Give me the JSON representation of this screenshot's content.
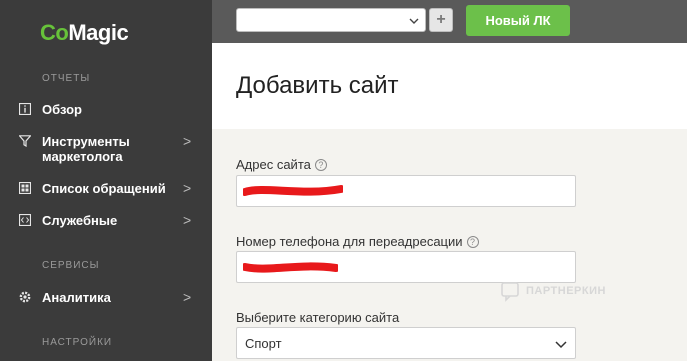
{
  "brand": {
    "logo_co": "Co",
    "logo_magic": "Magic",
    "accent": "#67c23a"
  },
  "sidebar": {
    "sections": {
      "reports": "ОТЧЕТЫ",
      "services": "СЕРВИСЫ",
      "settings": "НАСТРОЙКИ"
    },
    "items": [
      {
        "label": "Обзор",
        "icon": "info-icon",
        "chevron": ""
      },
      {
        "label": "Инструменты маркетолога",
        "icon": "filter-icon",
        "chevron": ">"
      },
      {
        "label": "Список обращений",
        "icon": "grid-icon",
        "chevron": ">"
      },
      {
        "label": "Служебные",
        "icon": "code-icon",
        "chevron": ">"
      },
      {
        "label": "Аналитика",
        "icon": "gear-icon",
        "chevron": ">"
      }
    ]
  },
  "topbar": {
    "account_select_value": "",
    "plus_label": "+",
    "new_button_label": "Новый ЛК"
  },
  "page": {
    "title": "Добавить сайт"
  },
  "form": {
    "site_address": {
      "label": "Адрес сайта",
      "help": "?",
      "value_redacted": true
    },
    "redirect_phone": {
      "label": "Номер телефона для переадресации",
      "help": "?",
      "value_redacted": true
    },
    "category": {
      "label": "Выберите категорию сайта",
      "value": "Спорт"
    }
  },
  "watermark": {
    "text": "ПАРТНЕРКИН"
  }
}
